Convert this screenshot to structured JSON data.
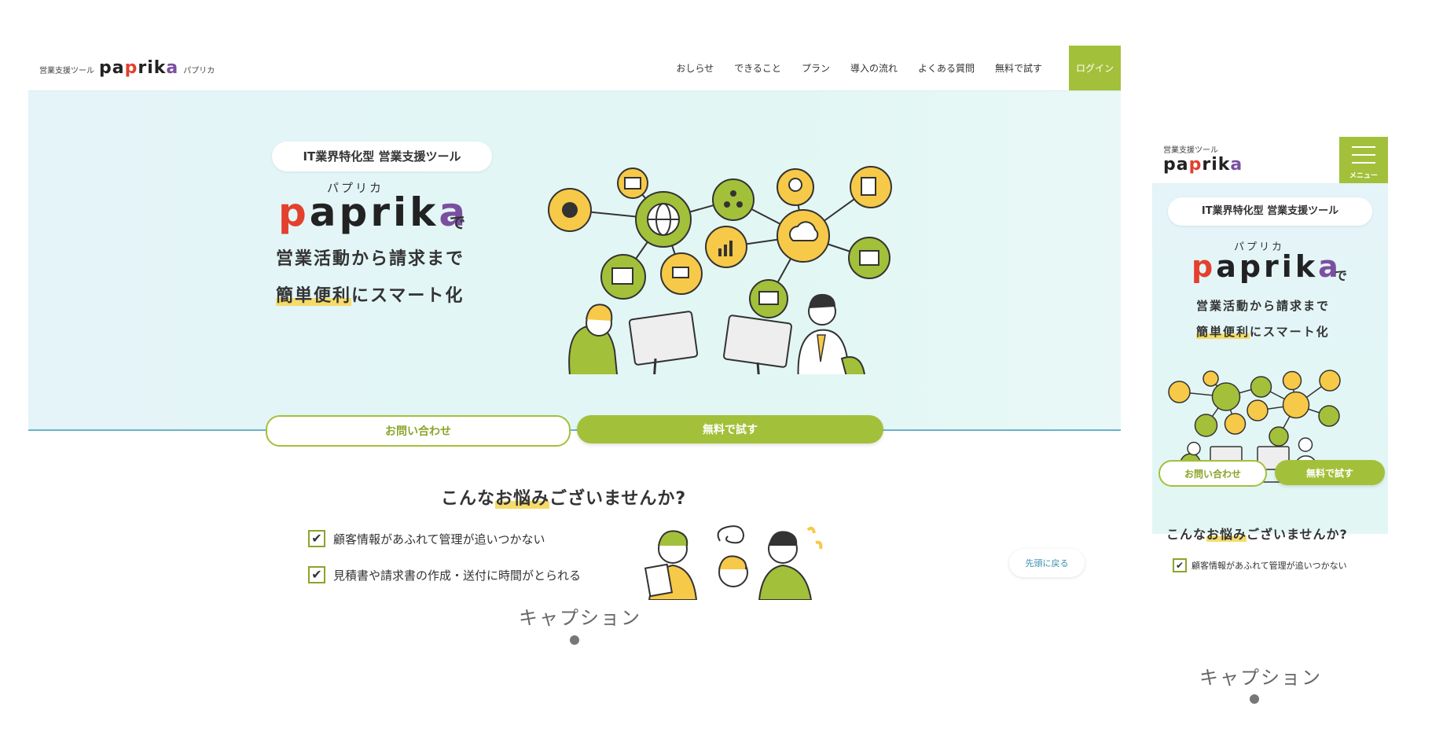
{
  "desktop": {
    "logo": {
      "tag": "営業支援ツール",
      "word_p": "pa",
      "word_r": "p",
      "word_mid": "rik",
      "word_a": "a",
      "kana": "パプリカ"
    },
    "nav": [
      "おしらせ",
      "できること",
      "プラン",
      "導入の流れ",
      "よくある質問",
      "無料で試す"
    ],
    "login": "ログイン",
    "hero": {
      "badge": "IT業界特化型 営業支援ツール",
      "ruby": "パプリカ",
      "brand": {
        "p1": "p",
        "rest": "aprik",
        "a": "a"
      },
      "de": "で",
      "line1": "営業活動から請求まで",
      "line2_hl": "簡単便利",
      "line2_rest": "にスマート化"
    },
    "buttons": {
      "contact": "お問い合わせ",
      "trial": "無料で試す"
    },
    "worries": {
      "title_a": "こんな",
      "title_hl": "お悩み",
      "title_b": "ございませんか?",
      "items": [
        "顧客情報があふれて管理が追いつかない",
        "見積書や請求書の作成・送付に時間がとられる"
      ]
    },
    "to_top": "先頭に戻る",
    "caption": "キャプション"
  },
  "mobile": {
    "logo": {
      "tag": "営業支援ツール",
      "word": "paprika"
    },
    "menu_label": "メニュー",
    "hero": {
      "badge": "IT業界特化型 営業支援ツール",
      "ruby": "パプリカ",
      "de": "で",
      "line1": "営業活動から請求まで",
      "line2_hl": "簡単便利",
      "line2_rest": "にスマート化"
    },
    "buttons": {
      "contact": "お問い合わせ",
      "trial": "無料で試す"
    },
    "worries": {
      "title_a": "こんな",
      "title_hl": "お悩み",
      "title_b": "ございませんか?",
      "items": [
        "顧客情報があふれて管理が追いつかない"
      ]
    },
    "caption": "キャプション"
  },
  "colors": {
    "accent": "#a3c03a",
    "hero_bg": "#e4f4f8",
    "highlight": "#f5dc6a",
    "icon_yellow": "#f7c948",
    "icon_green": "#a3c03a"
  }
}
